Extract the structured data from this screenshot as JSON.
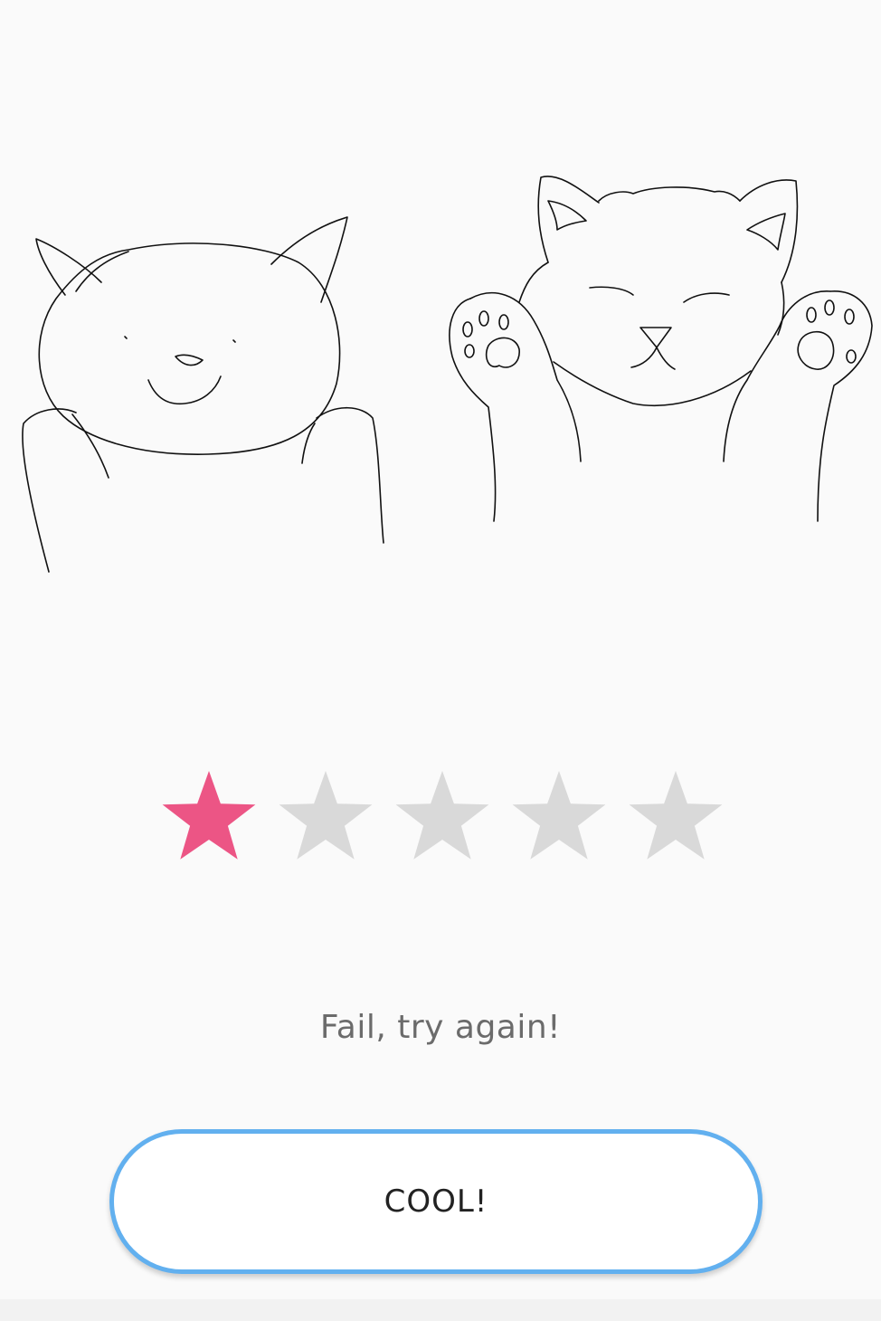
{
  "rating": {
    "score": 1,
    "max": 5,
    "filled_color": "#ec5585",
    "empty_color": "#d9d9d9"
  },
  "result": {
    "message": "Fail, try again!"
  },
  "button": {
    "label": "COOL!",
    "border_color": "#62b0ef"
  }
}
